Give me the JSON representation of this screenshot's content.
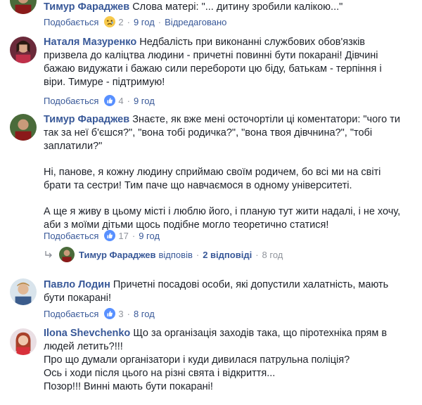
{
  "comments": [
    {
      "author": "Тимур Фараджев",
      "lines": [
        "Слова матері: \"... дитину зробили калікою...\""
      ],
      "reaction_count": "2",
      "time": "9 год"
    },
    {
      "author": "Наталя Мазуренко",
      "lines": [
        "Недбалість при виконанні службових обов'язків",
        "призвела до каліцтва людини - причетні повинні бути покарані! Дівчині",
        "бажаю видужати і бажаю сили перебороти цю біду, батькам - терпіння і",
        "віри. Тимуре - підтримую!"
      ],
      "like_label": "Подобається",
      "reaction_count": "4",
      "time": "9 год"
    },
    {
      "author": "Тимур Фараджев",
      "paragraphs": [
        [
          "Знаєте, як вже мені осточортіли ці коментатори: \"чого ти",
          "так за неї б'єшся?\", \"вона тобі родичка?\", \"вона твоя дівчнина?\", \"тобі",
          "заплатили?\""
        ],
        [
          "Ні, панове, я кожну людину сприймаю своїм родичем, бо всі ми на світі",
          "брати та сестри! Тим паче що навчаємося в одному університеті."
        ],
        [
          "А ще я живу в цьому місті і люблю його, і планую тут жити надалі, і не хочу,",
          "аби з моїми дітьми щось подібне могло теоретично статися!"
        ]
      ],
      "like_label": "Подобається",
      "reaction_count": "17",
      "time": "9 год"
    },
    {
      "author": "Павло Лодин",
      "lines": [
        "Причетні посадові особи, які допустили халатність, мають",
        "бути покарані!"
      ],
      "like_label": "Подобається",
      "reaction_count": "3",
      "time": "8 год"
    },
    {
      "author": "Ilona Shevchenko",
      "lines": [
        "Що за організація заходів така, що піротехніка прям в",
        "людей летить?!!!",
        "Про що думали організатори і куди дивилася патрульна поліція?",
        "Ось і ходи після цього на різні свята і відкриття...",
        "Позор!!! Винні мають бути покарані!"
      ]
    }
  ],
  "first_meta": {
    "like_label": "Подобається",
    "reply_label": "Відредаговано"
  },
  "reply_summary": {
    "name": "Тимур Фараджев",
    "verb": "відповів",
    "count": "2 відповіді",
    "time": "8 год"
  },
  "meta_separator": "·",
  "colors": {
    "link": "#385898",
    "meta": "#90949c",
    "like_blue": "#5890ff",
    "sad_yellow": "#f7c94b"
  },
  "icons": {
    "sad": "sad-reaction-icon",
    "like": "like-reaction-icon",
    "reply_arrow": "reply-arrow-icon"
  }
}
